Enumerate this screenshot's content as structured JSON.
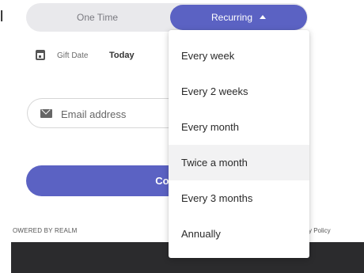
{
  "frequency": {
    "one_time_label": "One Time",
    "recurring_label": "Recurring",
    "accent_color": "#5b62c3"
  },
  "gift_date": {
    "label": "Gift Date",
    "value": "Today",
    "icon": "calendar-icon"
  },
  "email": {
    "placeholder": "Email address",
    "icon": "mail-icon"
  },
  "continue_label": "Cont",
  "footer": {
    "powered_by": "OWERED BY REALM",
    "privacy": "y Policy"
  },
  "left_edge_mark": "l",
  "recurring_menu": {
    "items": [
      {
        "label": "Every week"
      },
      {
        "label": "Every 2 weeks"
      },
      {
        "label": "Every month"
      },
      {
        "label": "Twice a month"
      },
      {
        "label": "Every 3 months"
      },
      {
        "label": "Annually"
      }
    ],
    "highlighted": "Twice a month"
  }
}
